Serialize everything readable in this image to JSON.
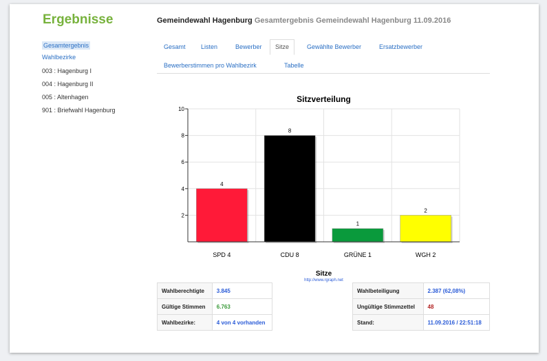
{
  "sidebar": {
    "title": "Ergebnisse",
    "active_link": "Gesamtergebnis",
    "section_link": "Wahlbezirke",
    "items": [
      "003 : Hagenburg I",
      "004 : Hagenburg II",
      "005 : Altenhagen",
      "901 : Briefwahl Hagenburg"
    ]
  },
  "header": {
    "title": "Gemeindewahl Hagenburg",
    "subtitle": "Gesamtergebnis Gemeindewahl Hagenburg 11.09.2016"
  },
  "tabs": [
    "Gesamt",
    "Listen",
    "Bewerber",
    "Sitze",
    "Gewählte Bewerber",
    "Ersatzbewerber",
    "Bewerberstimmen pro Wahlbezirk",
    "Tabelle"
  ],
  "active_tab": "Sitze",
  "chart_data": {
    "type": "bar",
    "title": "Sitzverteilung",
    "categories": [
      "SPD 4",
      "CDU 8",
      "GRÜNE 1",
      "WGH 2"
    ],
    "values": [
      4,
      8,
      1,
      2
    ],
    "colors": [
      "#ff1a38",
      "#000000",
      "#0a9a3c",
      "#ffff00"
    ],
    "ylim": [
      0,
      10
    ],
    "yticks": [
      "2",
      "4",
      "6",
      "8",
      "10"
    ],
    "xlabel": "Sitze",
    "caption": "http://www.rgraph.net",
    "grid": true
  },
  "stats_left": [
    {
      "label": "Wahlberechtigte",
      "value": "3.845",
      "color": "#2a5bd7"
    },
    {
      "label": "Gültige Stimmen",
      "value": "6.763",
      "color": "#3a9a3a"
    },
    {
      "label": "Wahlbezirke:",
      "value": "4 von 4 vorhanden",
      "color": "#2a5bd7"
    }
  ],
  "stats_right": [
    {
      "label": "Wahlbeteiligung",
      "value": "2.387 (62,08%)",
      "color": "#2a5bd7"
    },
    {
      "label": "Ungültige Stimmzettel",
      "value": "48",
      "color": "#b22222"
    },
    {
      "label": "Stand:",
      "value": "11.09.2016 / 22:51:18",
      "color": "#2a5bd7"
    }
  ]
}
